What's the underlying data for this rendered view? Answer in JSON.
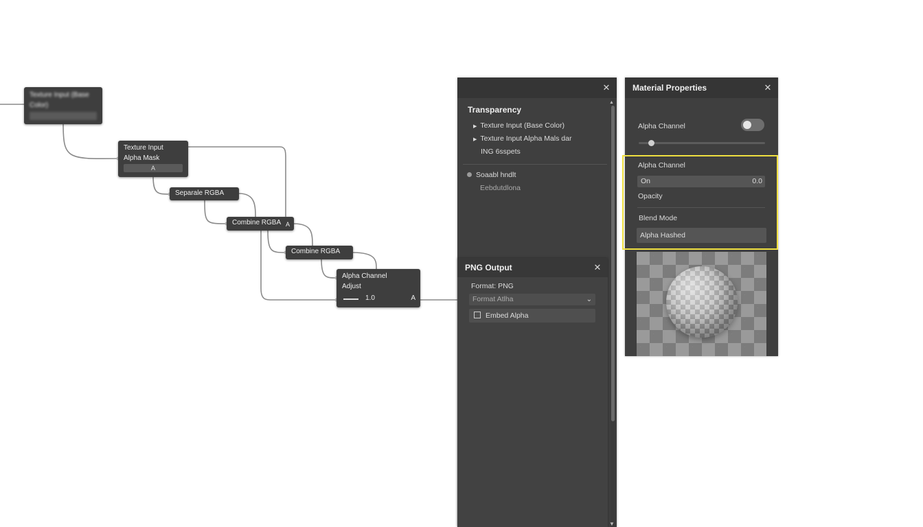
{
  "node_graph": {
    "nodes": {
      "texture_base": {
        "title": "Texture Input (Base Color)"
      },
      "texture_alpha": {
        "title_line1": "Texture Input",
        "title_line2": "Alpha Mask",
        "socket": "A"
      },
      "separate_rgba": {
        "title": "Separale RGBA"
      },
      "combine_rgba_1": {
        "title": "Combine RGBA",
        "socket": "A"
      },
      "combine_rgba_2": {
        "title": "Combine RGBA"
      },
      "alpha_adjust": {
        "title_line1": "Alpha Channel",
        "title_line2": "Adjust",
        "value": "1.0",
        "socket": "A"
      }
    }
  },
  "transparency_panel": {
    "title": "Transparency",
    "close_icon": "close-icon",
    "items": [
      {
        "label": "Texture Input (Base Color)"
      },
      {
        "label": "Texture Input Alpha Mals dar"
      }
    ],
    "sub_label": "ING 6sspets",
    "option_label": "Soaabl hndlt",
    "option_sub": "Eebdutdlona"
  },
  "png_output": {
    "title": "PNG Output",
    "close_icon": "close-icon",
    "format_label": "Format: PNG",
    "format_select_value": "Format Atlha",
    "embed_alpha_label": "Embed Alpha",
    "embed_alpha_checked": false
  },
  "material_properties": {
    "title": "Material Properties",
    "close_icon": "close-icon",
    "alpha_channel_toggle_label": "Alpha Channel",
    "alpha_channel_toggle_on": false,
    "slider_value": 0.1,
    "highlight_color": "#f0e040",
    "section": {
      "alpha_channel_label": "Alpha Channel",
      "on_label": "On",
      "on_value": "0.0",
      "opacity_label": "Opacity",
      "blend_mode_label": "Blend Mode",
      "blend_mode_value": "Alpha Hashed"
    }
  }
}
